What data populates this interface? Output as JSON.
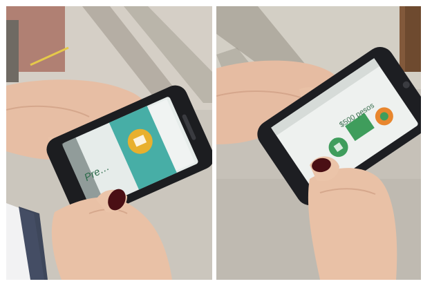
{
  "photos": [
    {
      "label": "left-photo",
      "screen_text": [
        "Pre…"
      ]
    },
    {
      "label": "right-photo",
      "screen_text": [
        "$500 pesos"
      ]
    }
  ],
  "colors": {
    "pavement": "#c8c2b7",
    "shadow": "#8d877c",
    "skin": "#e9c1a6",
    "skin_shade": "#cf9f84",
    "nail_polish": "#4a0f14",
    "phone_body": "#1e1f22",
    "screen_teal": "#2aa39a",
    "screen_green": "#3f9d5c",
    "screen_orange": "#e8862e",
    "sleeve": "#f3f3f4"
  }
}
